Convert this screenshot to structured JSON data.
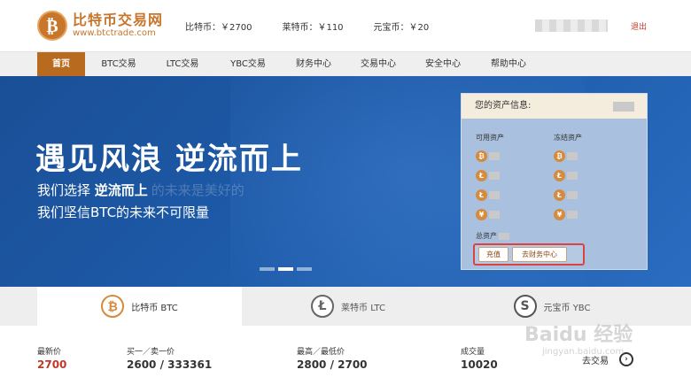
{
  "header": {
    "logo_symbol": "₿",
    "logo_name": "比特币交易网",
    "logo_url": "www.btctrade.com",
    "prices": [
      {
        "label": "比特币：￥2700"
      },
      {
        "label": "莱特币：￥110"
      },
      {
        "label": "元宝币：￥20"
      }
    ],
    "logout": "退出"
  },
  "nav": {
    "items": [
      {
        "label": "首页",
        "active": true
      },
      {
        "label": "BTC交易"
      },
      {
        "label": "LTC交易"
      },
      {
        "label": "YBC交易"
      },
      {
        "label": "财务中心"
      },
      {
        "label": "交易中心"
      },
      {
        "label": "安全中心"
      },
      {
        "label": "帮助中心"
      }
    ]
  },
  "banner": {
    "headline": "遇见风浪  逆流而上",
    "sub1_prefix": "我们选择 ",
    "sub1_bold": "逆流而上",
    "sub1_ghost": "的未来是美好的",
    "sub2": "我们坚信BTC的未来不可限量",
    "active_slide": 2,
    "slide_count": 3
  },
  "assets": {
    "title": "您的资产信息:",
    "available_label": "可用资产",
    "frozen_label": "冻结资产",
    "coin_symbols": [
      "₿",
      "Ł",
      "Ł",
      "¥"
    ],
    "total_label": "总资产",
    "recharge_button": "充值",
    "finance_button": "去财务中心"
  },
  "tabs": [
    {
      "icon": "₿",
      "label": "比特币 BTC",
      "active": true
    },
    {
      "icon": "Ł",
      "label": "莱特币 LTC"
    },
    {
      "icon": "S",
      "label": "元宝币 YBC"
    }
  ],
  "stats": {
    "latest_label": "最新价",
    "latest_value": "2700",
    "bid_ask_label": "买一／卖一价",
    "bid_ask_value": "2600 / 333361",
    "high_low_label": "最高／最低价",
    "high_low_value": "2800 / 2700",
    "volume_label": "成交量",
    "volume_value": "10020",
    "go_trade": "去交易",
    "go_arrow": "›"
  },
  "watermark": {
    "text": "Baidu 经验",
    "sub": "jingyan.baidu.com"
  }
}
